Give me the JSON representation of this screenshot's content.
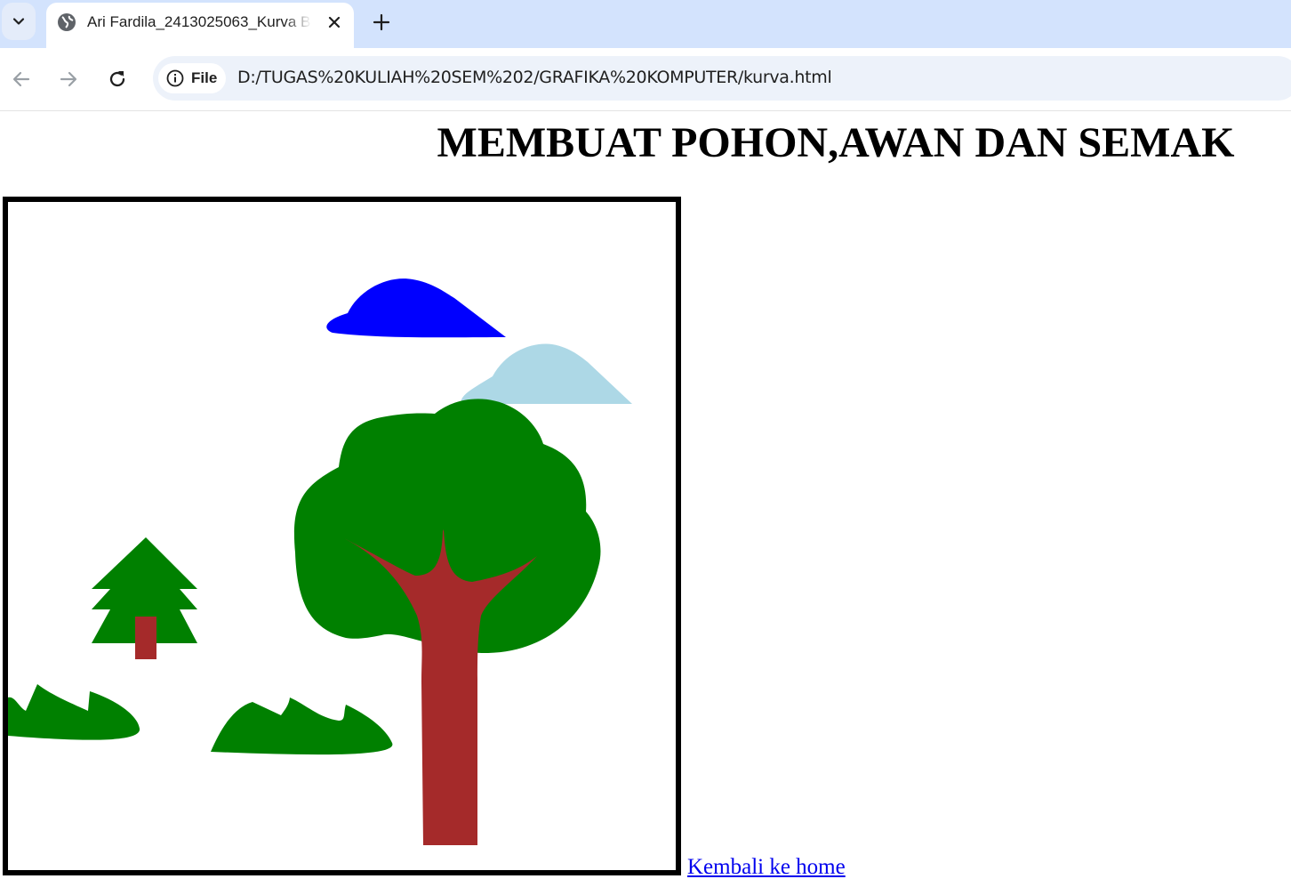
{
  "browser": {
    "tab": {
      "title": "Ari Fardila_2413025063_Kurva B"
    },
    "address_bar": {
      "chip_label": "File",
      "url": "D:/TUGAS%20KULIAH%20SEM%202/GRAFIKA%20KOMPUTER/kurva.html"
    }
  },
  "page": {
    "heading": "MEMBUAT POHON,AWAN DAN SEMAK",
    "home_link": "Kembali ke home"
  },
  "scene": {
    "cloud_colors": [
      "#0000ff",
      "#add8e6"
    ],
    "foliage_color": "#008000",
    "trunk_color": "#a52a2a",
    "border_color": "#000000"
  }
}
